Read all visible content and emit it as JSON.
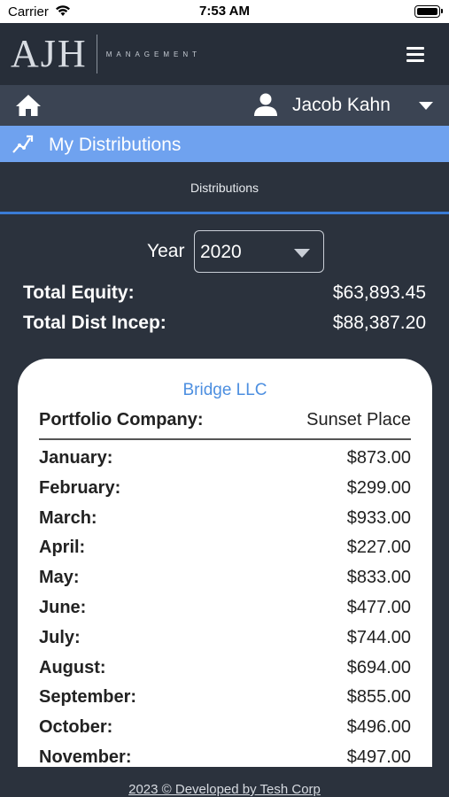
{
  "status_bar": {
    "carrier": "Carrier",
    "time": "7:53 AM"
  },
  "header": {
    "logo_mark": "AJH",
    "logo_sub": "MANAGEMENT"
  },
  "user_bar": {
    "user_name": "Jacob Kahn"
  },
  "section": {
    "title": "My Distributions"
  },
  "tab": {
    "label": "Distributions"
  },
  "filter": {
    "year_label": "Year",
    "year_value": "2020"
  },
  "totals": [
    {
      "label": "Total Equity:",
      "value": "$63,893.45"
    },
    {
      "label": "Total Dist Incep:",
      "value": "$88,387.20"
    }
  ],
  "card": {
    "company": "Bridge LLC",
    "portfolio_label": "Portfolio Company:",
    "portfolio_value": "Sunset Place",
    "months": [
      {
        "label": "January:",
        "value": "$873.00"
      },
      {
        "label": "February:",
        "value": "$299.00"
      },
      {
        "label": "March:",
        "value": "$933.00"
      },
      {
        "label": "April:",
        "value": "$227.00"
      },
      {
        "label": "May:",
        "value": "$833.00"
      },
      {
        "label": "June:",
        "value": "$477.00"
      },
      {
        "label": "July:",
        "value": "$744.00"
      },
      {
        "label": "August:",
        "value": "$694.00"
      },
      {
        "label": "September:",
        "value": "$855.00"
      },
      {
        "label": "October:",
        "value": "$496.00"
      },
      {
        "label": "November:",
        "value": "$497.00"
      }
    ]
  },
  "footer": {
    "text": "2023 © Developed by Tesh Corp"
  },
  "colors": {
    "background": "#2b323d",
    "section_bar": "#6fa2ef",
    "accent_blue": "#3a7bd5",
    "company_link": "#4d8fe0"
  }
}
